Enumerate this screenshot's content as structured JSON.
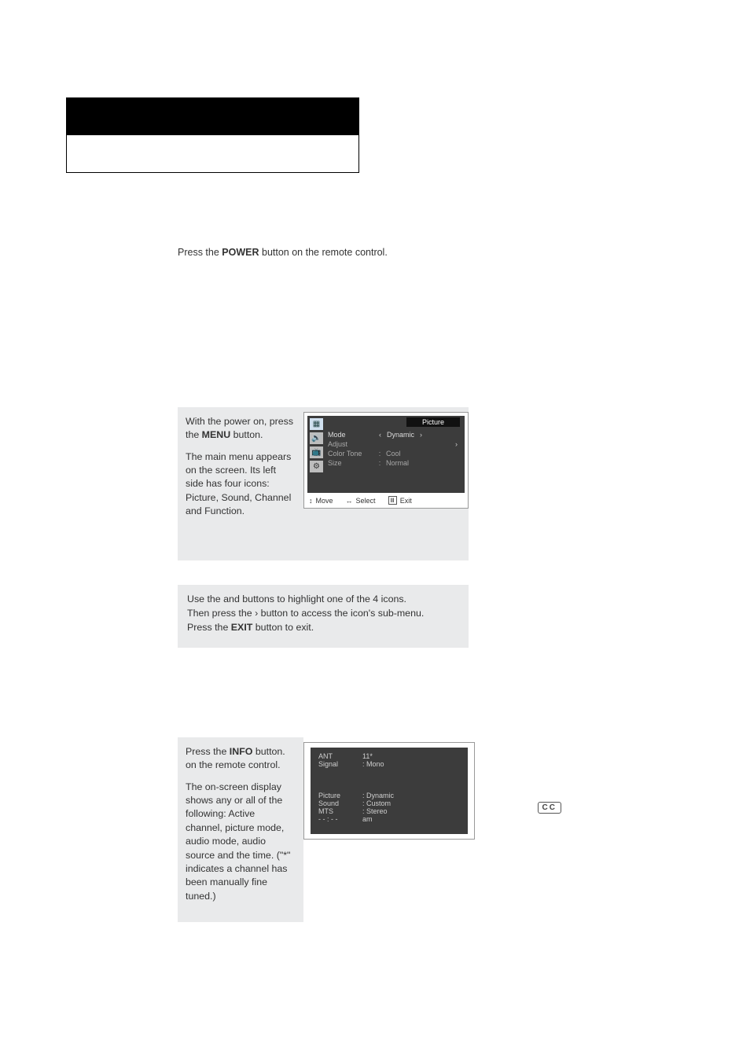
{
  "header": {
    "title": "",
    "subtitle": ""
  },
  "sec1": {
    "pre": "Press the ",
    "bold": "POWER",
    "post": " button on the remote control."
  },
  "sec2": {
    "p1_pre": "With the power on, press the ",
    "p1_bold": "MENU",
    "p1_post": " button.",
    "p2": "The main menu appears on the screen. Its left side has four icons: Picture, Sound, Channel and Function.",
    "osd": {
      "title": "Picture",
      "icons": {
        "picture": "▦",
        "sound": "🔊",
        "channel": "📺",
        "function": "⚙"
      },
      "rows": [
        {
          "label": "Mode",
          "sep": "",
          "value": "Dynamic",
          "arrows": true,
          "selected": true
        },
        {
          "label": "Adjust",
          "sep": "",
          "value": "",
          "arrows": false,
          "selected": false
        },
        {
          "label": "Color Tone",
          "sep": ":",
          "value": "Cool",
          "arrows": false,
          "selected": false
        },
        {
          "label": "Size",
          "sep": ":",
          "value": "Normal",
          "arrows": false,
          "selected": false
        }
      ],
      "footer": {
        "move": "Move",
        "select": "Select",
        "exit": "Exit"
      }
    }
  },
  "sec3": {
    "line1_a": "Use the ",
    "line1_b": " and ",
    "line1_c": " buttons to highlight one of the 4 icons.",
    "line2_a": "Then press the ",
    "line2_chev": "›",
    "line2_b": " button to access the icon's sub-menu.",
    "line3_a": "Press the ",
    "line3_bold": "EXIT",
    "line3_b": " button to exit."
  },
  "sec4": {
    "p1_pre": "Press the ",
    "p1_bold": "INFO",
    "p1_post": " button. on the remote control.",
    "p2": "The on-screen display shows any or all of the following: Active channel, picture mode, audio mode, audio source and the time. (\"*\" indicates a channel has been manually fine tuned.)",
    "info": {
      "top": [
        {
          "l": "ANT",
          "v": "11*"
        },
        {
          "l": "Signal",
          "v": ": Mono"
        }
      ],
      "bottom": [
        {
          "l": "Picture",
          "v": ": Dynamic"
        },
        {
          "l": "Sound",
          "v": ": Custom"
        },
        {
          "l": "MTS",
          "v": ": Stereo"
        },
        {
          "l": "- - : - -",
          "v": "am"
        }
      ]
    }
  },
  "cc": "CC"
}
